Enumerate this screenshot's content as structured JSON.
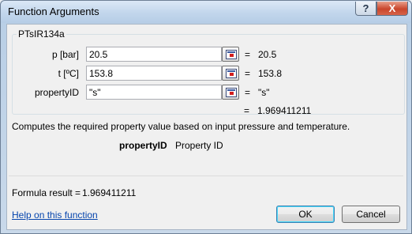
{
  "window": {
    "title": "Function Arguments",
    "help_glyph": "?",
    "close_glyph": "X"
  },
  "group": {
    "label": "PTsIR134a",
    "args": [
      {
        "label": "p [bar]",
        "value": "20.5",
        "result": "20.5"
      },
      {
        "label": "t [ºC]",
        "value": "153.8",
        "result": "153.8"
      },
      {
        "label": "propertyID",
        "value": "\"s\"",
        "result": "\"s\""
      }
    ],
    "equals": "="
  },
  "function_result": "1.969411211",
  "description": "Computes the required property value based on input pressure and temperature.",
  "parameter": {
    "name": "propertyID",
    "description": "Property ID"
  },
  "formula": {
    "label": "Formula result =",
    "value": "1.969411211"
  },
  "help_link": "Help on this function",
  "buttons": {
    "ok": "OK",
    "cancel": "Cancel"
  }
}
